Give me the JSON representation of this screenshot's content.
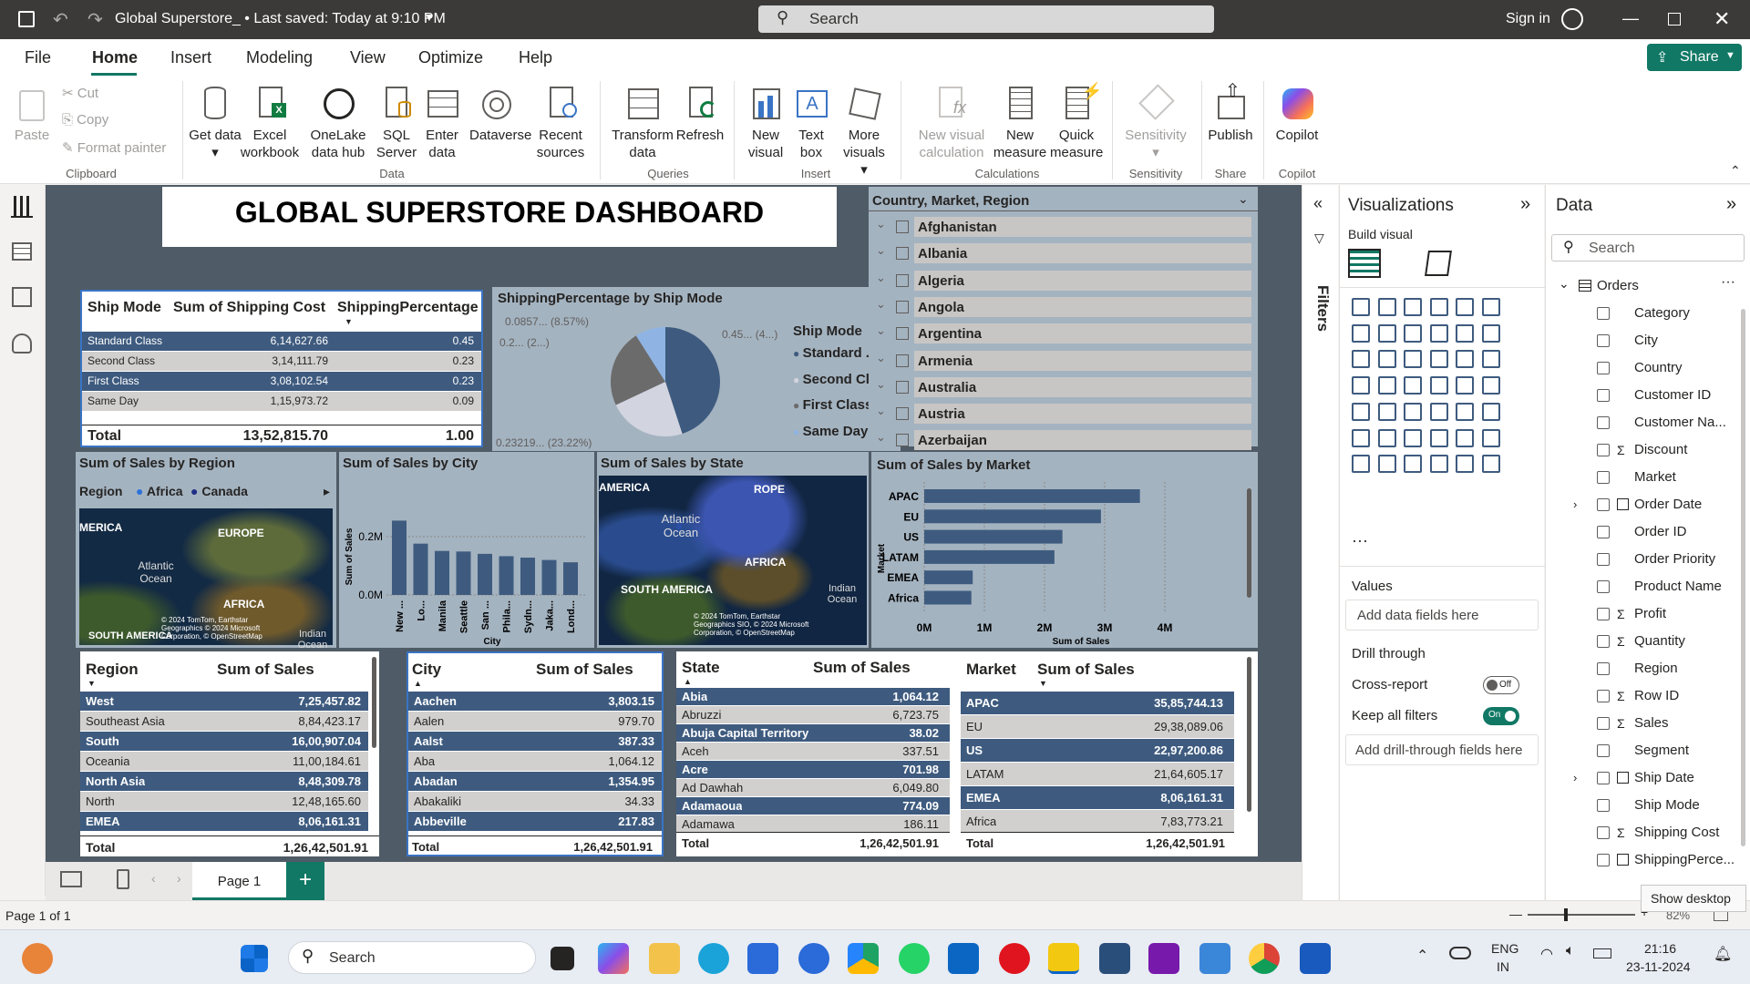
{
  "app": {
    "title": "Global Superstore_ • Last saved: Today at 9:10 PM",
    "search_placeholder": "Search",
    "sign_in": "Sign in"
  },
  "menu": {
    "items": [
      "File",
      "Home",
      "Insert",
      "Modeling",
      "View",
      "Optimize",
      "Help"
    ],
    "share": "Share"
  },
  "ribbon": {
    "clipboard": {
      "paste": "Paste",
      "cut": "Cut",
      "copy": "Copy",
      "format_painter": "Format painter",
      "group": "Clipboard"
    },
    "data": {
      "get_data": "Get data",
      "excel": "Excel workbook",
      "onelake": "OneLake data hub",
      "sql": "SQL Server",
      "enter": "Enter data",
      "dataverse": "Dataverse",
      "recent": "Recent sources",
      "group": "Data"
    },
    "queries": {
      "transform": "Transform data",
      "refresh": "Refresh",
      "group": "Queries"
    },
    "insert": {
      "new_visual": "New visual",
      "text_box": "Text box",
      "more_visuals": "More visuals",
      "group": "Insert"
    },
    "calculations": {
      "new_visual_calc": "New visual calculation",
      "new_measure": "New measure",
      "quick_measure": "Quick measure",
      "group": "Calculations"
    },
    "sensitivity": {
      "label": "Sensitivity",
      "group": "Sensitivity"
    },
    "share": {
      "publish": "Publish",
      "group": "Share"
    },
    "copilot": {
      "label": "Copilot",
      "group": "Copilot"
    }
  },
  "dashboard": {
    "title": "GLOBAL SUPERSTORE DASHBOARD",
    "shipmode_table": {
      "headers": [
        "Ship Mode",
        "Sum of Shipping Cost",
        "ShippingPercentage"
      ],
      "rows": [
        [
          "Standard Class",
          "6,14,627.66",
          "0.45"
        ],
        [
          "Second Class",
          "3,14,111.79",
          "0.23"
        ],
        [
          "First Class",
          "3,08,102.54",
          "0.23"
        ],
        [
          "Same Day",
          "1,15,973.72",
          "0.09"
        ]
      ],
      "total": [
        "Total",
        "13,52,815.70",
        "1.00"
      ]
    },
    "pie": {
      "title": "ShippingPercentage by Ship Mode",
      "labels": [
        "0.0857... (8.57%)",
        "0.2... (2...)",
        "0.45... (4...)",
        "0.23219... (23.22%)"
      ],
      "legend_title": "Ship Mode",
      "legend": [
        "Standard ...",
        "Second Cl...",
        "First Class",
        "Same Day"
      ]
    },
    "slicer": {
      "title": "Country, Market, Region",
      "items": [
        "Afghanistan",
        "Albania",
        "Algeria",
        "Angola",
        "Argentina",
        "Armenia",
        "Australia",
        "Austria",
        "Azerbaijan"
      ]
    },
    "map_region": {
      "title": "Sum of Sales by Region",
      "legend_label": "Region",
      "legend": [
        "Africa",
        "Canada"
      ],
      "labels": [
        "MERICA",
        "EUROPE",
        "Atlantic Ocean",
        "AFRICA",
        "SOUTH AMERICA",
        "Indian Ocean"
      ],
      "credit": "© 2024 TomTom, Earthstar Geographics © 2024 Microsoft Corporation, © OpenStreetMap"
    },
    "city_chart": {
      "title": "Sum of Sales by City",
      "ylabel": "Sum of Sales",
      "xlabel": "City",
      "ticks": [
        "0.2M",
        "0.0M"
      ]
    },
    "map_state": {
      "title": "Sum of Sales by State",
      "labels": [
        "AMERICA",
        "ROPE",
        "Atlantic Ocean",
        "AFRICA",
        "SOUTH AMERICA",
        "Indian Ocean"
      ],
      "credit": "© 2024 TomTom, Earthstar Geographics SIO, © 2024 Microsoft Corporation, © OpenStreetMap"
    },
    "market_chart": {
      "title": "Sum of Sales by Market",
      "ylabel": "Market",
      "xlabel": "Sum of Sales",
      "xticks": [
        "0M",
        "1M",
        "2M",
        "3M",
        "4M"
      ]
    },
    "region_table": {
      "headers": [
        "Region",
        "Sum of Sales"
      ],
      "rows": [
        [
          "West",
          "7,25,457.82"
        ],
        [
          "Southeast Asia",
          "8,84,423.17"
        ],
        [
          "South",
          "16,00,907.04"
        ],
        [
          "Oceania",
          "11,00,184.61"
        ],
        [
          "North Asia",
          "8,48,309.78"
        ],
        [
          "North",
          "12,48,165.60"
        ],
        [
          "EMEA",
          "8,06,161.31"
        ]
      ],
      "total": [
        "Total",
        "1,26,42,501.91"
      ]
    },
    "city_table": {
      "headers": [
        "City",
        "Sum of Sales"
      ],
      "rows": [
        [
          "Aachen",
          "3,803.15"
        ],
        [
          "Aalen",
          "979.70"
        ],
        [
          "Aalst",
          "387.33"
        ],
        [
          "Aba",
          "1,064.12"
        ],
        [
          "Abadan",
          "1,354.95"
        ],
        [
          "Abakaliki",
          "34.33"
        ],
        [
          "Abbeville",
          "217.83"
        ]
      ],
      "total": [
        "Total",
        "1,26,42,501.91"
      ]
    },
    "state_table": {
      "headers": [
        "State",
        "Sum of Sales"
      ],
      "rows": [
        [
          "Abia",
          "1,064.12"
        ],
        [
          "Abruzzi",
          "6,723.75"
        ],
        [
          "Abuja Capital Territory",
          "38.02"
        ],
        [
          "Aceh",
          "337.51"
        ],
        [
          "Acre",
          "701.98"
        ],
        [
          "Ad Dawhah",
          "6,049.80"
        ],
        [
          "Adamaoua",
          "774.09"
        ],
        [
          "Adamawa",
          "186.11"
        ]
      ],
      "total": [
        "Total",
        "1,26,42,501.91"
      ]
    },
    "market_table": {
      "headers": [
        "Market",
        "Sum of Sales"
      ],
      "rows": [
        [
          "APAC",
          "35,85,744.13"
        ],
        [
          "EU",
          "29,38,089.06"
        ],
        [
          "US",
          "22,97,200.86"
        ],
        [
          "LATAM",
          "21,64,605.17"
        ],
        [
          "EMEA",
          "8,06,161.31"
        ],
        [
          "Africa",
          "7,83,773.21"
        ]
      ],
      "total": [
        "Total",
        "1,26,42,501.91"
      ]
    }
  },
  "chart_data": [
    {
      "type": "pie",
      "title": "ShippingPercentage by Ship Mode",
      "categories": [
        "Standard Class",
        "Second Class",
        "First Class",
        "Same Day"
      ],
      "values": [
        0.45,
        0.23,
        0.23,
        0.09
      ],
      "colors": [
        "#3e5b7f",
        "#d2d4e0",
        "#6b6b6b",
        "#8fb4e3"
      ]
    },
    {
      "type": "bar",
      "title": "Sum of Sales by City",
      "categories": [
        "New ...",
        "Lo...",
        "Manila",
        "Seattle",
        "San ...",
        "Phila...",
        "Sydn...",
        "Jaka...",
        "Lond..."
      ],
      "values": [
        255000,
        176000,
        151000,
        149000,
        141000,
        133000,
        128000,
        120000,
        112000
      ],
      "ylabel": "Sum of Sales",
      "xlabel": "City"
    },
    {
      "type": "bar",
      "title": "Sum of Sales by Market",
      "categories": [
        "APAC",
        "EU",
        "US",
        "LATAM",
        "EMEA",
        "Africa"
      ],
      "values": [
        3585744.13,
        2938089.06,
        2297200.86,
        2164605.17,
        806161.31,
        783773.21
      ],
      "xlim": [
        0,
        4000000
      ],
      "ylabel": "Market",
      "xlabel": "Sum of Sales"
    }
  ],
  "filters": {
    "label": "Filters"
  },
  "viz": {
    "title": "Visualizations",
    "build": "Build visual",
    "values": "Values",
    "add_fields": "Add data fields here",
    "drill": "Drill through",
    "cross": "Cross-report",
    "cross_state": "Off",
    "keep": "Keep all filters",
    "keep_state": "On",
    "add_drill": "Add drill-through fields here"
  },
  "data_pane": {
    "title": "Data",
    "search": "Search",
    "table": "Orders",
    "fields": [
      "Category",
      "City",
      "Country",
      "Customer ID",
      "Customer Na...",
      "Discount",
      "Market",
      "Order Date",
      "Order ID",
      "Order Priority",
      "Product Name",
      "Profit",
      "Quantity",
      "Region",
      "Row ID",
      "Sales",
      "Segment",
      "Ship Date",
      "Ship Mode",
      "Shipping Cost",
      "ShippingPerce..."
    ]
  },
  "pages": {
    "tab": "Page 1",
    "status": "Page 1 of 1",
    "zoom": "82%",
    "tooltip": "Show desktop"
  },
  "taskbar": {
    "search": "Search",
    "lang": "ENG",
    "region": "IN",
    "time": "21:16",
    "date": "23-11-2024"
  }
}
